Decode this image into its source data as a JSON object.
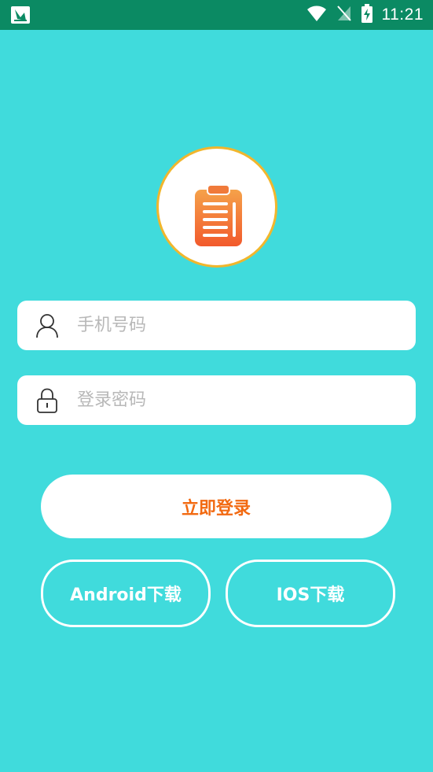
{
  "status_bar": {
    "time": "11:21",
    "icons": [
      "app-notification-icon",
      "wifi-icon",
      "no-sim-icon",
      "battery-charging-icon"
    ]
  },
  "logo": {
    "icon": "clipboard-icon",
    "colors": {
      "border": "#f1b62d",
      "clipboard_top": "#f5a24a",
      "clipboard_bottom": "#f25a2c"
    }
  },
  "form": {
    "phone": {
      "placeholder": "手机号码",
      "value": "",
      "icon": "user-icon"
    },
    "password": {
      "placeholder": "登录密码",
      "value": "",
      "icon": "lock-icon"
    }
  },
  "buttons": {
    "login": "立即登录",
    "android_download": "Android下载",
    "ios_download": "IOS下载"
  },
  "colors": {
    "background": "#40dbdc",
    "status_bar": "#0b8a63",
    "login_text": "#f26a12"
  }
}
